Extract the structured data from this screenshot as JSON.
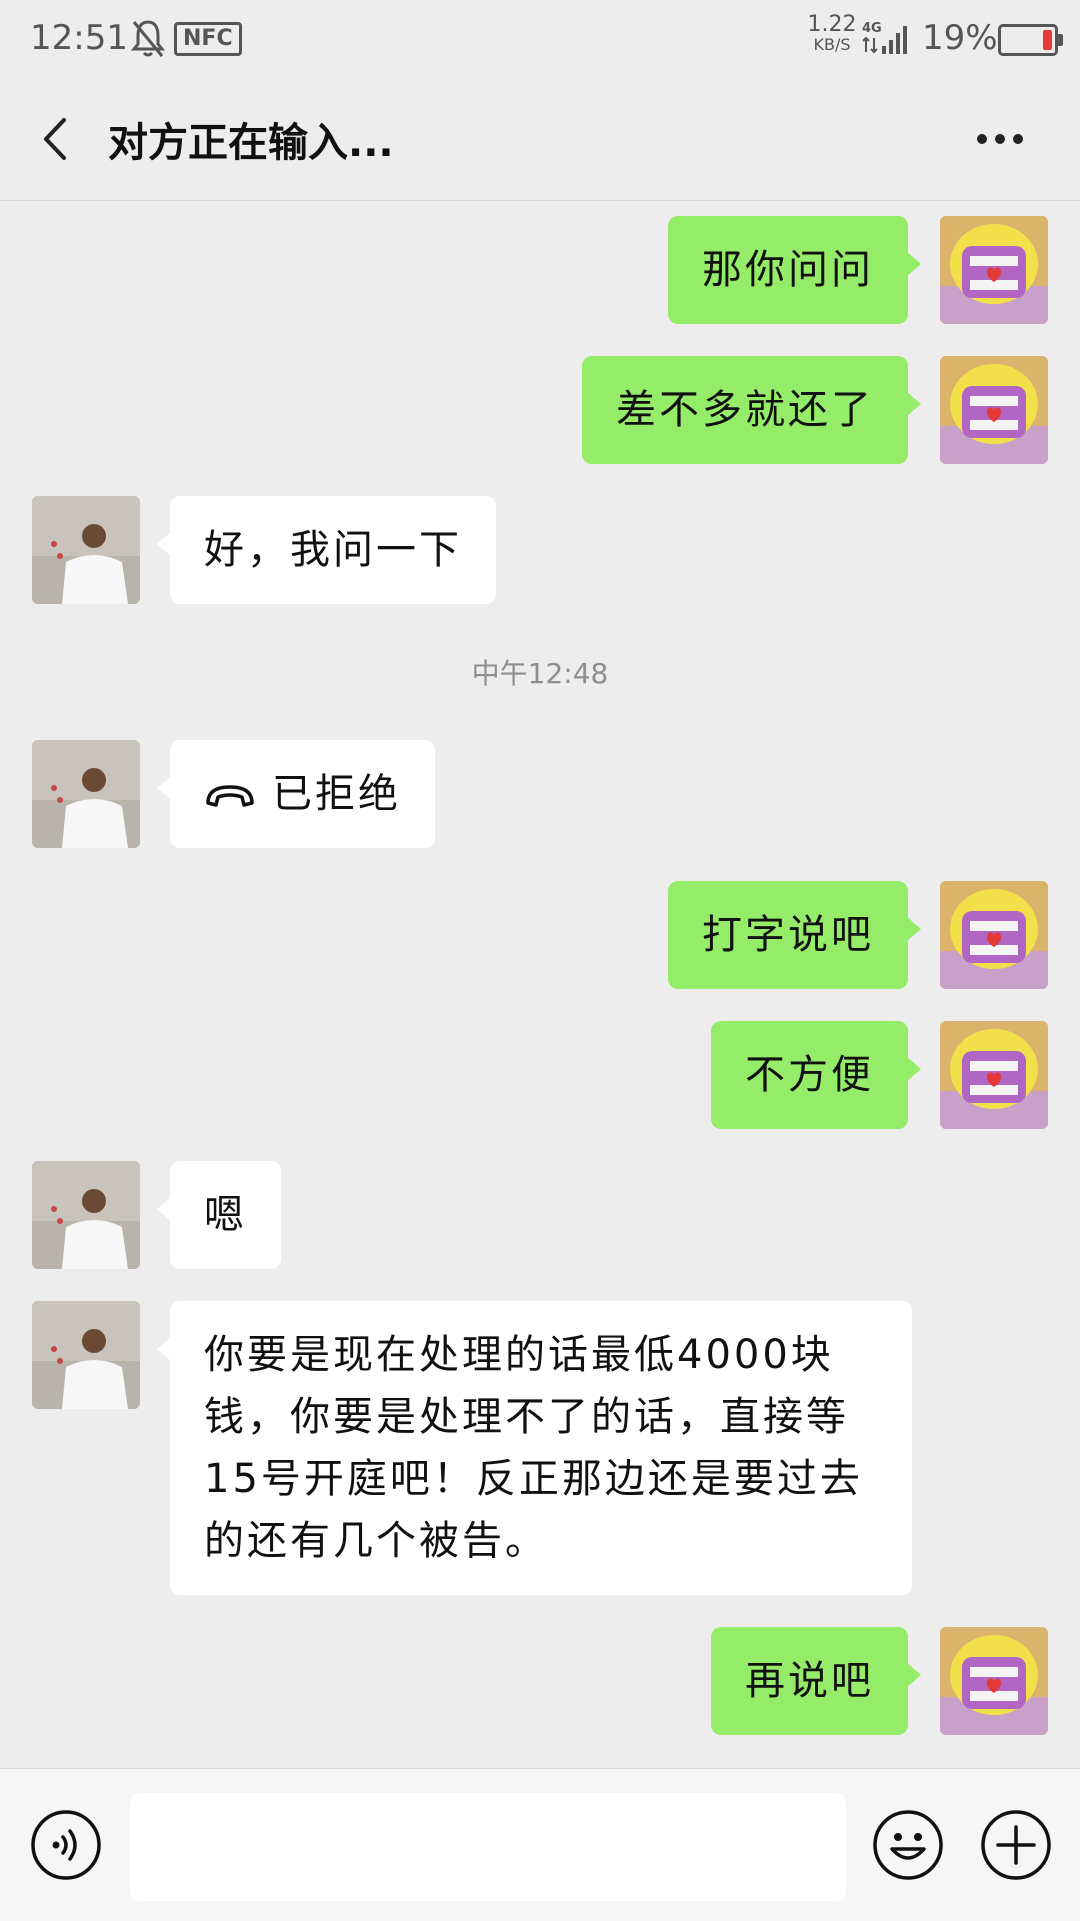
{
  "status_bar": {
    "time": "12:51",
    "nfc": "NFC",
    "net_speed_value": "1.22",
    "net_speed_unit": "KB/S",
    "network": "4G",
    "battery_text": "19%",
    "battery_level": 0.19,
    "battery_color": "#e53935"
  },
  "header": {
    "title": "对方正在输入...",
    "back_icon": "chevron-left-icon",
    "more_icon": "more-dots-icon"
  },
  "messages": [
    {
      "side": "me",
      "text": "那你问问"
    },
    {
      "side": "me",
      "text": "差不多就还了"
    },
    {
      "side": "them",
      "text": "好，我问一下"
    },
    {
      "type": "timestamp",
      "text": "中午12:48"
    },
    {
      "side": "them",
      "text": "已拒绝",
      "icon": "phone-hangup-icon"
    },
    {
      "side": "me",
      "text": "打字说吧"
    },
    {
      "side": "me",
      "text": "不方便"
    },
    {
      "side": "them",
      "text": "嗯"
    },
    {
      "side": "them",
      "text": "你要是现在处理的话最低4000块钱，你要是处理不了的话，直接等15号开庭吧！反正那边还是要过去的还有几个被告。"
    },
    {
      "side": "me",
      "text": "再说吧"
    }
  ],
  "bottom_bar": {
    "input_value": "",
    "voice_icon": "voice-icon",
    "emoji_icon": "emoji-icon",
    "plus_icon": "plus-icon"
  },
  "colors": {
    "my_bubble": "#95ec69",
    "their_bubble": "#ffffff",
    "background": "#ededed"
  }
}
